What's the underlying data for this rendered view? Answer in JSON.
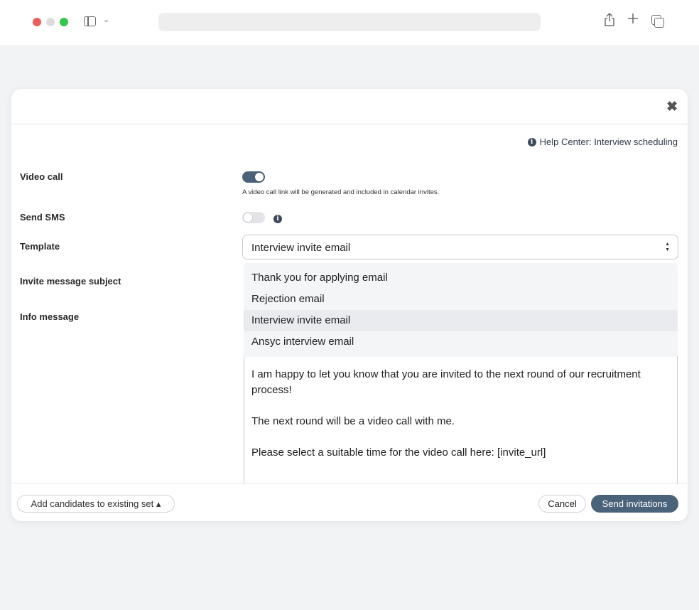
{
  "browser": {
    "sidebar_chevron": "⌄"
  },
  "modal": {
    "close_glyph": "✖",
    "help_info_glyph": "i",
    "help_link": "Help Center: Interview scheduling",
    "video_call": {
      "label": "Video call",
      "enabled": true,
      "hint": "A video call link will be generated and included in calendar invites."
    },
    "send_sms": {
      "label": "Send SMS",
      "enabled": false,
      "info_glyph": "i"
    },
    "template": {
      "label": "Template",
      "selected": "Interview invite email",
      "arrow_up": "▲",
      "arrow_down": "▼",
      "options": [
        "Thank you for applying email",
        "Rejection email",
        "Interview invite email",
        "Ansyc interview email"
      ]
    },
    "invite_subject_label": "Invite message subject",
    "info_message": {
      "label": "Info message",
      "paragraphs": [
        "I am happy to let you know that you are invited to the next round of our recruitment process!",
        "The next round will be a video call with me.",
        "Please select a suitable time for the video call here: [invite_url]"
      ]
    },
    "footer": {
      "add_candidates": "Add candidates to existing set",
      "add_caret": "▴",
      "cancel": "Cancel",
      "send": "Send invitations"
    }
  }
}
